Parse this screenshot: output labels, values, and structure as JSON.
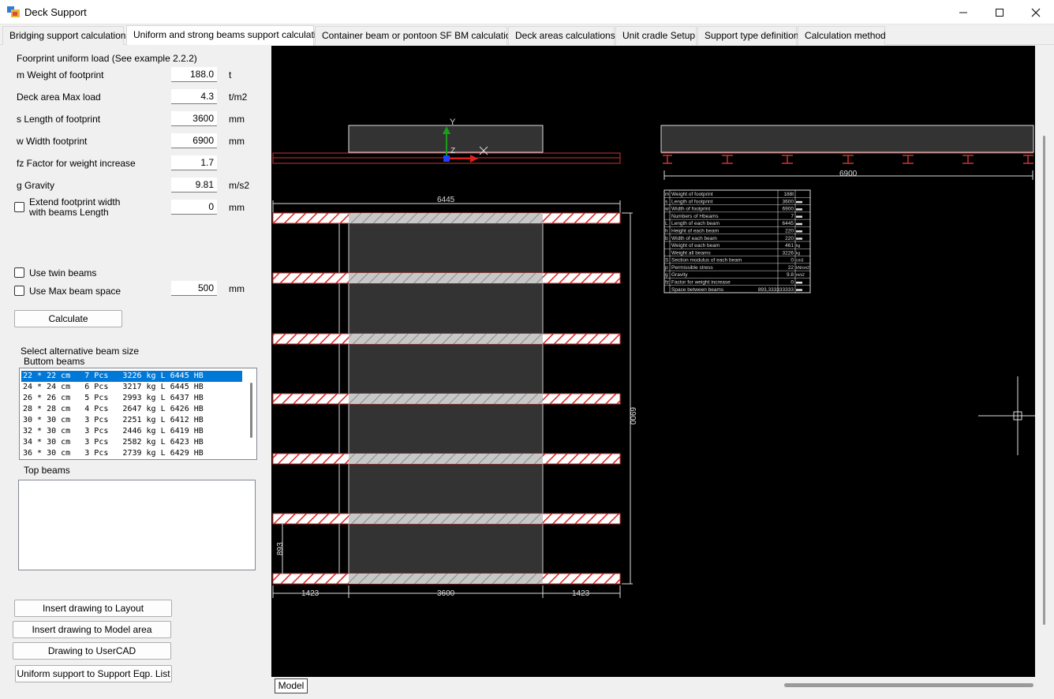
{
  "window": {
    "title": "Deck Support"
  },
  "tabs": [
    "Bridging support calculations",
    "Uniform and strong beams support calculations",
    "Container beam or pontoon SF BM calculations",
    "Deck areas calculations",
    "Unit cradle Setup",
    "Support type definition",
    "Calculation method"
  ],
  "form": {
    "header": "Foorprint uniform load  (See example 2.2.2)",
    "weight": {
      "label": "m Weight of footprint",
      "value": "188.0",
      "unit": "t"
    },
    "deck_max_load": {
      "label": "Deck area Max load",
      "value": "4.3",
      "unit": "t/m2"
    },
    "length": {
      "label": "s Length of footprint",
      "value": "3600",
      "unit": "mm"
    },
    "width": {
      "label": "w Width footprint",
      "value": "6900",
      "unit": "mm"
    },
    "factor": {
      "label": "fz Factor for weight increase",
      "value": "1.7"
    },
    "gravity": {
      "label": "g Gravity",
      "value": "9.81",
      "unit": "m/s2"
    },
    "extend": {
      "label_line1": "Extend footprint width",
      "label_line2": "with beams Length",
      "value": "0",
      "unit": "mm"
    },
    "twin_beams": "Use twin beams",
    "max_beam_space": {
      "label": "Use Max beam space",
      "value": "500",
      "unit": "mm"
    },
    "calculate": "Calculate",
    "select_alt": "Select alternative beam size",
    "bottom_beams_label": "Buttom beams",
    "bottom_beams": [
      "22 * 22 cm   7 Pcs   3226 kg L 6445 HB",
      "24 * 24 cm   6 Pcs   3217 kg L 6445 HB",
      "26 * 26 cm   5 Pcs   2993 kg L 6437 HB",
      "28 * 28 cm   4 Pcs   2647 kg L 6426 HB",
      "30 * 30 cm   3 Pcs   2251 kg L 6412 HB",
      "32 * 30 cm   3 Pcs   2446 kg L 6419 HB",
      "34 * 30 cm   3 Pcs   2582 kg L 6423 HB",
      "36 * 30 cm   3 Pcs   2739 kg L 6429 HB"
    ],
    "top_beams_label": "Top beams",
    "buttons": {
      "insert_layout": "Insert drawing to Layout",
      "insert_model": "Insert drawing to Model area",
      "usercad": "Drawing to UserCAD",
      "uniform_support": "Uniform support to Support Eqp. List"
    }
  },
  "drawing": {
    "dim_top": "6445",
    "dim_right": "6900",
    "dim_left_small": "893",
    "dim_bottom_left": "1423",
    "dim_bottom_mid": "3600",
    "dim_bottom_right": "1423",
    "dim_side_view": "6900",
    "axis_y": "Y",
    "axis_z": "Z",
    "info_table": [
      [
        "m",
        "Weight of footprint",
        "188t"
      ],
      [
        "s",
        "Length of footprint",
        "3600"
      ],
      [
        "w",
        "Width of footprint",
        "6900"
      ],
      [
        "",
        "Numbers of Hbeams",
        "7"
      ],
      [
        "L",
        "Length of each beam",
        "6445"
      ],
      [
        "h",
        "Height of each beam",
        "220"
      ],
      [
        "b",
        "Width of each beam",
        "220"
      ],
      [
        "",
        "Weight of each beam",
        "461"
      ],
      [
        "",
        "Weight all beams",
        "3226"
      ],
      [
        "S",
        "Section modulus of each beam",
        "0"
      ],
      [
        "p",
        "Permissible stress",
        "22"
      ],
      [
        "g",
        "Gravity",
        "9.8"
      ],
      [
        "fz",
        "Factor for weight increase",
        "0"
      ],
      [
        "",
        "Space between beams",
        "893,333333333"
      ]
    ],
    "info_units": [
      "",
      "",
      "",
      "",
      "",
      "",
      "",
      "kg",
      "kg",
      "cm3",
      "kN/cm2",
      "m/s2",
      "",
      ""
    ]
  },
  "status": {
    "model_tab": "Model"
  }
}
